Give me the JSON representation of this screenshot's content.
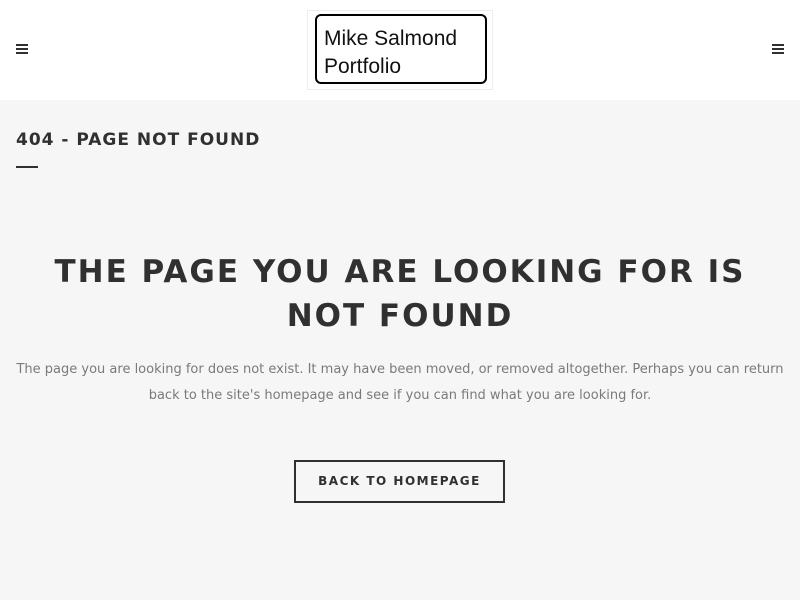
{
  "header": {
    "logo": {
      "line1": "Mike Salmond",
      "line2": "Portfolio"
    },
    "left_menu_icon": "hamburger-menu-icon",
    "right_menu_icon": "hamburger-menu-icon"
  },
  "page": {
    "title": "404 - PAGE NOT FOUND",
    "headline": "THE PAGE YOU ARE LOOKING FOR IS NOT FOUND",
    "message": "The page you are looking for does not exist. It may have been moved, or removed altogether. Perhaps you can return back to the site's homepage and see if you can find what you are looking for.",
    "button_label": "BACK TO HOMEPAGE"
  },
  "colors": {
    "background": "#f6f6f6",
    "header_background": "#ffffff",
    "text": "#303030",
    "muted_text": "#7a7a7a"
  }
}
